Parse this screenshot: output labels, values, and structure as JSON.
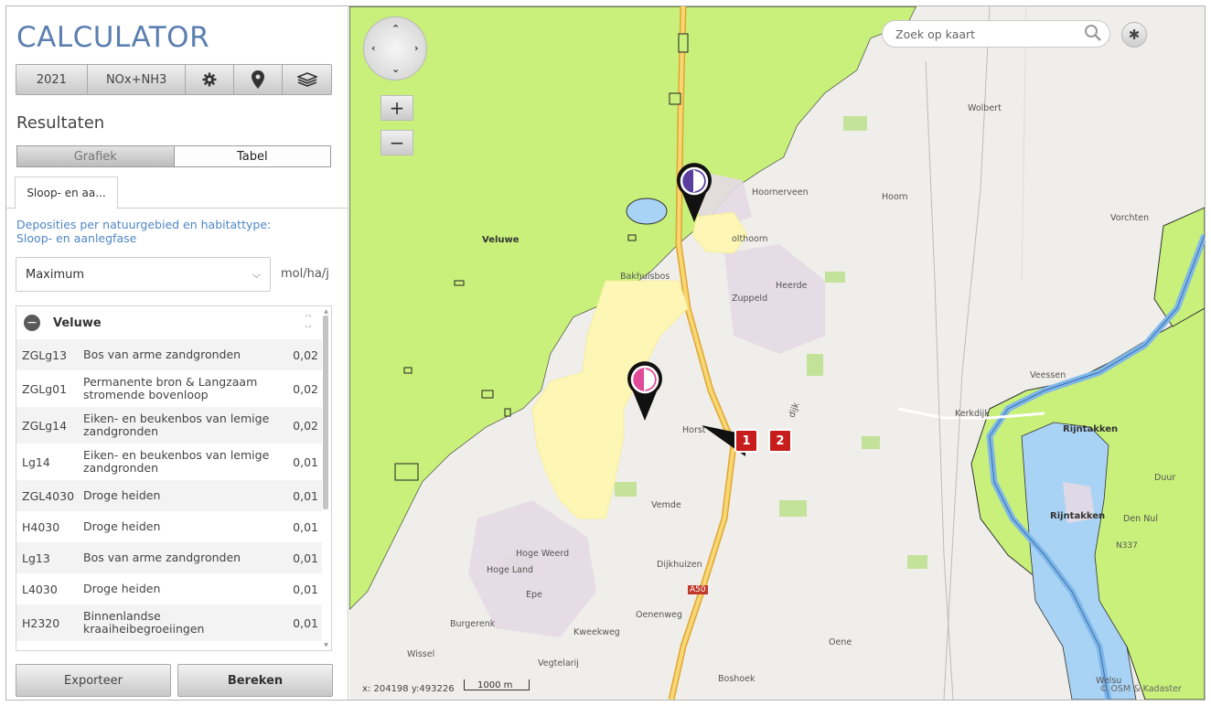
{
  "app": {
    "title": "CALCULATOR"
  },
  "toolbar": {
    "year": "2021",
    "substance": "NOx+NH3"
  },
  "results": {
    "title": "Resultaten",
    "views": {
      "chart": "Grafiek",
      "table": "Tabel",
      "active": "Tabel"
    },
    "tab": "Sloop- en aa...",
    "subtitle": "Deposities per natuurgebied en habitattype: Sloop- en aanlegfase",
    "select_value": "Maximum",
    "unit": "mol/ha/j",
    "group": "Veluwe",
    "rows": [
      {
        "code": "ZGLg13",
        "name": "Bos van arme zandgronden",
        "value": "0,02"
      },
      {
        "code": "ZGLg01",
        "name": "Permanente bron & Langzaam stromende bovenloop",
        "value": "0,02"
      },
      {
        "code": "ZGLg14",
        "name": "Eiken- en beukenbos van lemige zandgronden",
        "value": "0,02"
      },
      {
        "code": "Lg14",
        "name": "Eiken- en beukenbos van lemige zandgronden",
        "value": "0,01"
      },
      {
        "code": "ZGL4030",
        "name": "Droge heiden",
        "value": "0,01"
      },
      {
        "code": "H4030",
        "name": "Droge heiden",
        "value": "0,01"
      },
      {
        "code": "Lg13",
        "name": "Bos van arme zandgronden",
        "value": "0,01"
      },
      {
        "code": "L4030",
        "name": "Droge heiden",
        "value": "0,01"
      },
      {
        "code": "H2320",
        "name": "Binnenlandse kraaiheibegroeiingen",
        "value": "0,01"
      }
    ]
  },
  "actions": {
    "export": "Exporteer",
    "calculate": "Bereken"
  },
  "map": {
    "search_placeholder": "Zoek op kaart",
    "coords": "x: 204198 y:493226",
    "scale": "1000 m",
    "copyright": "© OSM & Kadaster",
    "markers": [
      "1",
      "2"
    ],
    "labels": {
      "veluwe": "Veluwe",
      "hoornerveen": "Hoornerveen",
      "hoorn": "Hoorn",
      "wolbert": "Wolbert",
      "vorchten": "Vorchten",
      "holthoorn": "olthoorn",
      "bakhuisbos": "Bakhuisbos",
      "heerde": "Heerde",
      "zuppeld": "Zuppeld",
      "veessen": "Veessen",
      "kerkdijk": "Kerkdijk",
      "rijntakken1": "Rijntakken",
      "rijntakken2": "Rijntakken",
      "duur": "Duur",
      "dennul": "Den Nul",
      "horst": "Horst",
      "vemde": "Vemde",
      "hogeweerd": "Hoge Weerd",
      "hogeland": "Hoge Land",
      "dijkhuizen": "Dijkhuizen",
      "epe": "Epe",
      "oenenweg": "Oenenweg",
      "burgerenk": "Burgerenk",
      "kweekweg": "Kweekweg",
      "wissel": "Wissel",
      "vegtelarij": "Vegtelarij",
      "oene": "Oene",
      "boshoek": "Boshoek",
      "welsum": "Welsu",
      "a50": "A50",
      "n337": "N337",
      "dijk": "dijk"
    }
  },
  "colors": {
    "nature": "#c8f07a",
    "water": "#a9d3f5",
    "road": "#f3c24b",
    "hex": "#fdf6b4"
  }
}
